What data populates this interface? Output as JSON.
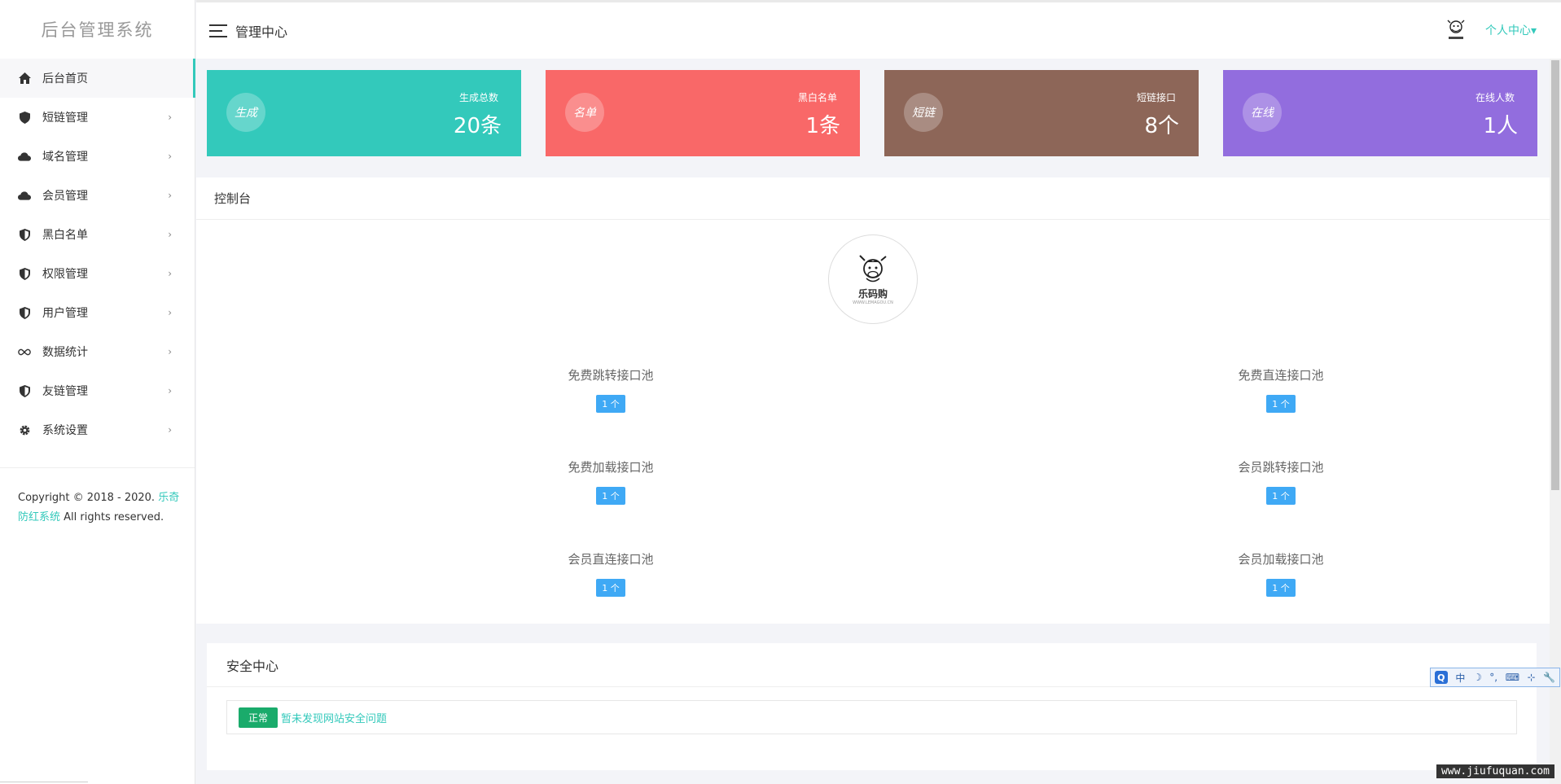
{
  "sidebar": {
    "brand": "后台管理系统",
    "items": [
      {
        "label": "后台首页",
        "icon": "home-icon",
        "caret": ""
      },
      {
        "label": "短链管理",
        "icon": "shield-icon",
        "caret": "›"
      },
      {
        "label": "域名管理",
        "icon": "cloud-icon",
        "caret": "›"
      },
      {
        "label": "会员管理",
        "icon": "cloud-icon",
        "caret": "›"
      },
      {
        "label": "黑白名单",
        "icon": "shield-half-icon",
        "caret": "›"
      },
      {
        "label": "权限管理",
        "icon": "shield-half-icon",
        "caret": "›"
      },
      {
        "label": "用户管理",
        "icon": "shield-half-icon",
        "caret": "›"
      },
      {
        "label": "数据统计",
        "icon": "infinity-icon",
        "caret": "›"
      },
      {
        "label": "友链管理",
        "icon": "shield-half-icon",
        "caret": "›"
      },
      {
        "label": "系统设置",
        "icon": "gear-icon",
        "caret": "›"
      }
    ],
    "copyright_prefix": "Copyright © 2018 - 2020. ",
    "copyright_link": "乐奇防红系统",
    "copyright_suffix": " All rights reserved."
  },
  "topbar": {
    "title": "管理中心",
    "user_center": "个人中心▾"
  },
  "cards": [
    {
      "circle": "生成",
      "label": "生成总数",
      "value": "20条",
      "color": "#33c9bb"
    },
    {
      "circle": "名单",
      "label": "黑白名单",
      "value": "1条",
      "color": "#f96868"
    },
    {
      "circle": "短链",
      "label": "短链接口",
      "value": "8个",
      "color": "#8d6658"
    },
    {
      "circle": "在线",
      "label": "在线人数",
      "value": "1人",
      "color": "#926dde"
    }
  ],
  "console": {
    "title": "控制台",
    "logo_name": "乐码购",
    "logo_sub": "WWW.LEMAGOU.CN",
    "pools": [
      {
        "name": "免费跳转接口池",
        "badge": "1 个"
      },
      {
        "name": "免费直连接口池",
        "badge": "1 个"
      },
      {
        "name": "免费加载接口池",
        "badge": "1 个"
      },
      {
        "name": "会员跳转接口池",
        "badge": "1 个"
      },
      {
        "name": "会员直连接口池",
        "badge": "1 个"
      },
      {
        "name": "会员加载接口池",
        "badge": "1 个"
      }
    ]
  },
  "security": {
    "title": "安全中心",
    "status": "正常",
    "message": "暂未发现网站安全问题"
  },
  "ime": {
    "items": [
      "Q",
      "中",
      "☽",
      "°,",
      "⌨",
      "⊹",
      "🔧"
    ]
  },
  "watermark": "www.jiufuquan.com"
}
